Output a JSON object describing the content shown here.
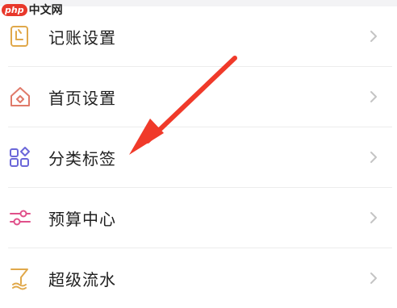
{
  "watermark": {
    "badge": "php",
    "text": "中文网"
  },
  "menu": {
    "items": [
      {
        "label": "记账设置",
        "icon": "bookkeeping-icon",
        "color": "#e0a84a"
      },
      {
        "label": "首页设置",
        "icon": "home-icon",
        "color": "#e07a6a"
      },
      {
        "label": "分类标签",
        "icon": "category-icon",
        "color": "#6b67d9"
      },
      {
        "label": "预算中心",
        "icon": "sliders-icon",
        "color": "#e0508a"
      },
      {
        "label": "超级流水",
        "icon": "flow-icon",
        "color": "#e0a84a"
      }
    ]
  },
  "annotation": {
    "arrow_color": "#f03a2a"
  }
}
